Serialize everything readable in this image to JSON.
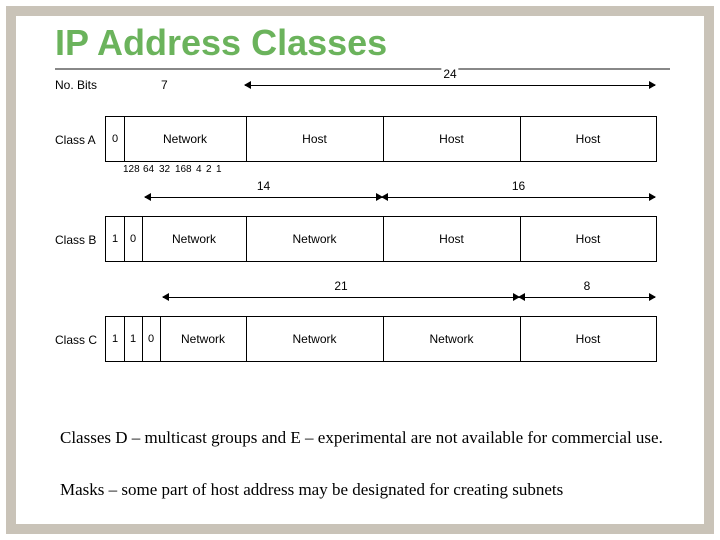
{
  "title": "IP Address Classes",
  "diagram": {
    "headers": {
      "bits": "No. Bits",
      "net_a": "7",
      "host_a": "24",
      "net_b": "14",
      "host_b": "16",
      "net_c": "21",
      "host_c": "8"
    },
    "classA": {
      "label": "Class A",
      "bits": [
        "0"
      ],
      "segments": [
        "Network",
        "Host",
        "Host",
        "Host"
      ],
      "bitvals": [
        "128",
        "64",
        "32",
        "16",
        "8",
        "4",
        "2",
        "1"
      ]
    },
    "classB": {
      "label": "Class B",
      "bits": [
        "1",
        "0"
      ],
      "segments": [
        "Network",
        "Network",
        "Host",
        "Host"
      ]
    },
    "classC": {
      "label": "Class C",
      "bits": [
        "1",
        "1",
        "0"
      ],
      "segments": [
        "Network",
        "Network",
        "Network",
        "Host"
      ]
    }
  },
  "notes": [
    "Classes D – multicast groups and E – experimental are not available for commercial use.",
    "Masks – some part of host address may be designated for creating subnets"
  ]
}
